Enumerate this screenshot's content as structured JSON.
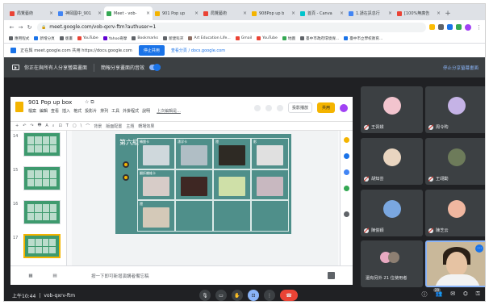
{
  "browser": {
    "tabs": [
      {
        "title": "局覽藝術",
        "color": "#ea4335",
        "active": false
      },
      {
        "title": "神岡國中_901",
        "color": "#4285f4",
        "active": false
      },
      {
        "title": "Meet - vob-",
        "color": "#34a853",
        "active": true
      },
      {
        "title": "901 Pop up",
        "color": "#f4b400",
        "active": false
      },
      {
        "title": "局覽藝術",
        "color": "#ea4335",
        "active": false
      },
      {
        "title": "908Pop up b",
        "color": "#f4b400",
        "active": false
      },
      {
        "title": "首頁 - Canva",
        "color": "#00c4cc",
        "active": false
      },
      {
        "title": "1.請在訊息行",
        "color": "#4285f4",
        "active": false
      },
      {
        "title": "[100%無廣告",
        "color": "#ea4335",
        "active": false
      }
    ],
    "new_tab": "+",
    "url": "meet.google.com/vob-qxrv-ftm?authuser=1",
    "bookmarks": [
      "應用程式",
      "新增分頁",
      "版畫",
      "YouTube",
      "Yahoo奇摩",
      "Bookmarks",
      "新建科夾",
      "Art Education Life...",
      "Gmail",
      "YouTube",
      "地圖",
      "臺中市政府環境保...",
      "臺中市立學校教育..."
    ]
  },
  "share_notice": {
    "text": "正在與 meet.google.com 共用 https://docs.google.com",
    "stop_button": "停止共用",
    "show_button": "查看分頁 / docs.google.com"
  },
  "presenting_bar": {
    "text": "你正在與所有人分享螢幕畫面",
    "audio_label": "簡報分享畫面的音效",
    "stop_link": "停止分享螢幕畫面"
  },
  "slides": {
    "doc_title": "901 Pop up box",
    "menu": [
      "檔案",
      "編輯",
      "查看",
      "插入",
      "格式",
      "投影片",
      "排列",
      "工具",
      "外掛程式",
      "說明"
    ],
    "last_edit": "上次編輯是...",
    "present_label": "投影播放",
    "share_label": "共用",
    "toolbar": [
      "+",
      "↶",
      "↷",
      "🖶",
      "A",
      "⌕",
      "⊡",
      "T",
      "▢",
      "\\",
      "⌒",
      "背景",
      "版面配置",
      "主題",
      "轉場效果"
    ],
    "thumb_numbers": [
      "14",
      "15",
      "16",
      "17"
    ],
    "slide_title": "第六組",
    "cells": [
      {
        "label": "轉盤卡",
        "color": "#cfd8dc"
      },
      {
        "label": "漂浮卡",
        "color": "#b0bec5"
      },
      {
        "label": "隱",
        "color": "#2e2a24"
      },
      {
        "label": "影",
        "color": "#e0e0e0"
      },
      {
        "label": "翻折纖維卡",
        "color": "#d7ccc8"
      },
      {
        "label": "",
        "color": "#3e2723"
      },
      {
        "label": "",
        "color": "#cfe0a8"
      },
      {
        "label": "",
        "color": "#c8b8c0"
      },
      {
        "label": "隱",
        "color": "#d4c9b8"
      },
      {
        "label": "",
        "color": ""
      },
      {
        "label": "",
        "color": ""
      },
      {
        "label": "",
        "color": ""
      }
    ],
    "speaker_notes": "按一下即可新增演講者備忘稿"
  },
  "participants": [
    {
      "name": "王胥媃",
      "avatar_color": "#f2c4ce"
    },
    {
      "name": "周令昀",
      "avatar_color": "#c5b3e6"
    },
    {
      "name": "胡知芸",
      "avatar_color": "#e9d5c0"
    },
    {
      "name": "王翊勳",
      "avatar_color": "#6d7b5a"
    },
    {
      "name": "陳俊穎",
      "avatar_color": "#7aa7e0"
    },
    {
      "name": "陳芝云",
      "avatar_color": "#f0b7a0"
    }
  ],
  "others_label": "還有另外 21 位使用者",
  "meet": {
    "time": "上午10:44",
    "separator": "|",
    "code": "vob-qxrv-ftm",
    "participant_count": "29"
  }
}
